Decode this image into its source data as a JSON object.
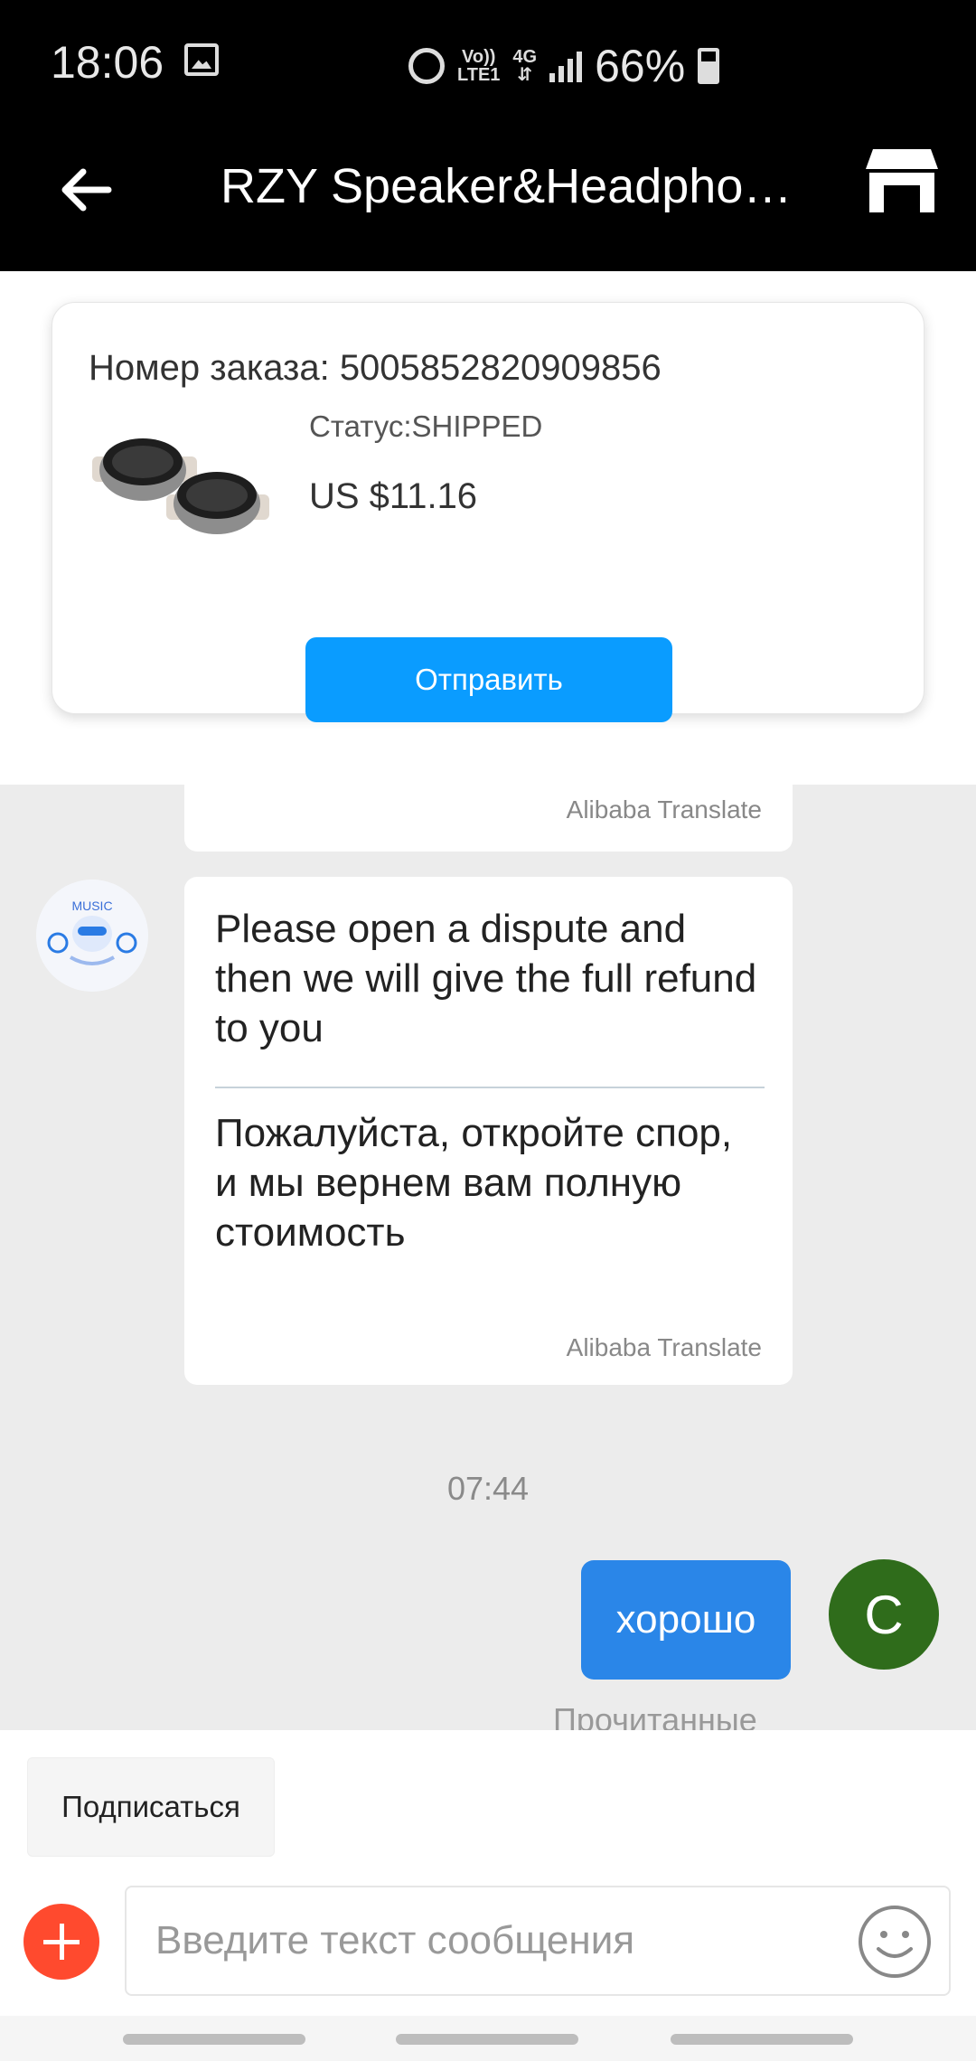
{
  "status_bar": {
    "time": "18:06",
    "volte": "Vo))",
    "lte": "LTE1",
    "network": "4G",
    "battery": "66%"
  },
  "app_bar": {
    "title": "RZY Speaker&Headphone Store"
  },
  "order_card": {
    "order_number": "Номер заказа: 5005852820909856",
    "status": "Статус:SHIPPED",
    "price": "US $11.16",
    "send_label": "Отправить"
  },
  "chat": {
    "partial_credit": "Alibaba Translate",
    "messages": [
      {
        "original": "Please open a dispute and then we will give the full refund to you",
        "translated": "Пожалуйста, откройте спор, и мы вернем вам полную стоимость",
        "credit": "Alibaba Translate"
      }
    ],
    "timestamp": "07:44",
    "my_message": "хорошо",
    "my_avatar_letter": "С",
    "read_status": "Прочитанные"
  },
  "shop_avatar_text": "MUSIC",
  "composer": {
    "subscribe_label": "Подписаться",
    "placeholder": "Введите текст сообщения"
  },
  "icons": {
    "back": "arrow-left",
    "store": "storefront",
    "add": "plus-circle",
    "emoji": "smiley"
  }
}
